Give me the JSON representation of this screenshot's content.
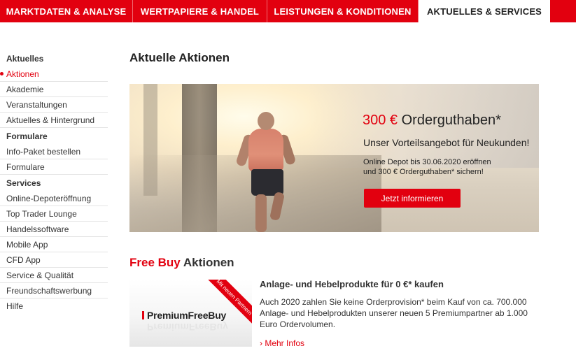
{
  "topnav": {
    "tabs": [
      {
        "label": "MARKTDATEN & ANALYSE"
      },
      {
        "label": "WERTPAPIERE & HANDEL"
      },
      {
        "label": "LEISTUNGEN & KONDITIONEN"
      },
      {
        "label": "AKTUELLES & SERVICES",
        "active": true
      }
    ]
  },
  "sidebar": {
    "groups": [
      {
        "title": "Aktuelles",
        "items": [
          {
            "label": "Aktionen",
            "active": true
          },
          {
            "label": "Akademie"
          },
          {
            "label": "Veranstaltungen"
          },
          {
            "label": "Aktuelles & Hintergrund"
          }
        ]
      },
      {
        "title": "Formulare",
        "items": [
          {
            "label": "Info-Paket bestellen"
          },
          {
            "label": "Formulare"
          }
        ]
      },
      {
        "title": "Services",
        "items": [
          {
            "label": "Online-Depoteröffnung"
          },
          {
            "label": "Top Trader Lounge"
          },
          {
            "label": "Handelssoftware"
          },
          {
            "label": "Mobile App"
          },
          {
            "label": "CFD App"
          },
          {
            "label": "Service & Qualität"
          },
          {
            "label": "Freundschaftswerbung"
          },
          {
            "label": "Hilfe"
          }
        ]
      }
    ]
  },
  "main": {
    "title": "Aktuelle Aktionen",
    "banner": {
      "headline_amount": "300 €",
      "headline_text": "Orderguthaben*",
      "subline": "Unser Vorteilsangebot für Neukunden!",
      "detail_line1": "Online Depot bis 30.06.2020 eröffnen",
      "detail_line2": "und 300 € Orderguthaben* sichern!",
      "cta_label": "Jetzt informieren"
    },
    "freebuy": {
      "section_title_red": "Free Buy",
      "section_title_rest": "Aktionen",
      "logo_text": "PremiumFreeBuy",
      "ribbon_text": "Mit neuen Partnern",
      "heading": "Anlage- und Hebelprodukte für 0 €* kaufen",
      "text": "Auch 2020 zahlen Sie keine Orderprovision* beim Kauf von ca. 700.000 Anlage- und Hebelprodukten unserer neuen 5 Premiumpartner ab 1.000 Euro Ordervolumen.",
      "more_label": "› Mehr Infos"
    }
  },
  "colors": {
    "brand_red": "#e2000f"
  }
}
